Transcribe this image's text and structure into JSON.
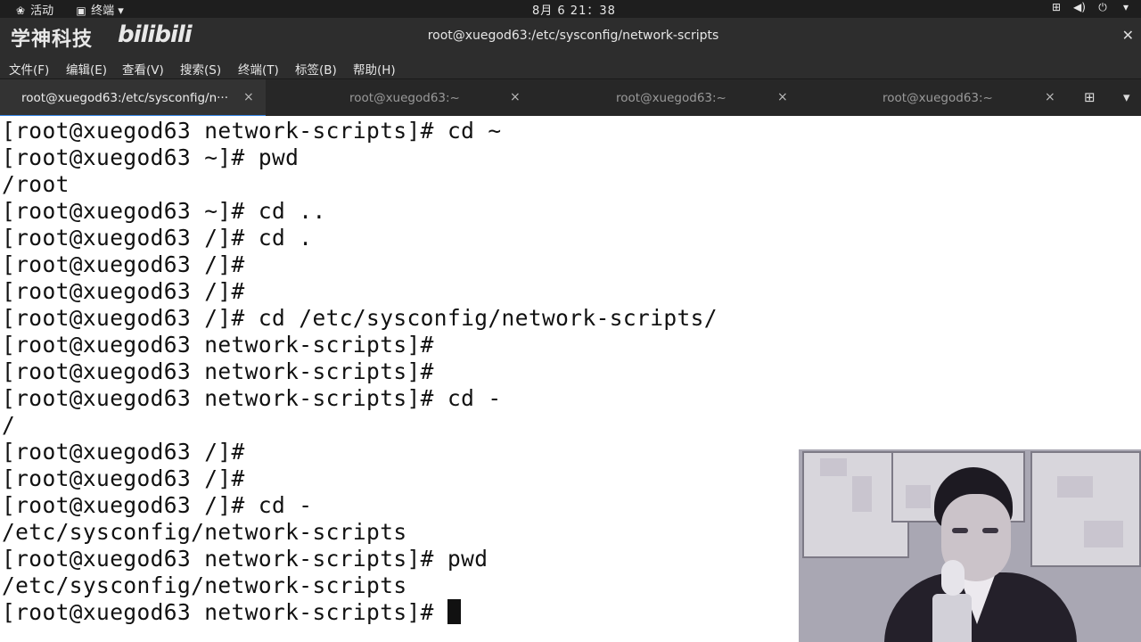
{
  "topbar": {
    "activities": "活动",
    "app_menu": "终端",
    "clock": "8月 6 21：38",
    "icons": [
      "network-icon",
      "volume-icon",
      "power-icon"
    ]
  },
  "window": {
    "watermark": "学神科技",
    "bilibili_logo": "bilibili",
    "title": "root@xuegod63:/etc/sysconfig/network-scripts"
  },
  "menubar": {
    "items": [
      "文件(F)",
      "编辑(E)",
      "查看(V)",
      "搜索(S)",
      "终端(T)",
      "标签(B)",
      "帮助(H)"
    ]
  },
  "tabs": [
    {
      "label": "root@xuegod63:/etc/sysconfig/n···",
      "active": true
    },
    {
      "label": "root@xuegod63:~",
      "active": false
    },
    {
      "label": "root@xuegod63:~",
      "active": false
    },
    {
      "label": "root@xuegod63:~",
      "active": false
    }
  ],
  "terminal": {
    "lines": [
      "[root@xuegod63 network-scripts]# cd ~",
      "[root@xuegod63 ~]# pwd",
      "/root",
      "[root@xuegod63 ~]# cd ..",
      "[root@xuegod63 /]# cd .",
      "[root@xuegod63 /]#",
      "[root@xuegod63 /]#",
      "[root@xuegod63 /]# cd /etc/sysconfig/network-scripts/",
      "[root@xuegod63 network-scripts]#",
      "[root@xuegod63 network-scripts]#",
      "[root@xuegod63 network-scripts]# cd -",
      "/",
      "[root@xuegod63 /]#",
      "[root@xuegod63 /]#",
      "[root@xuegod63 /]# cd -",
      "/etc/sysconfig/network-scripts",
      "[root@xuegod63 network-scripts]# pwd",
      "/etc/sysconfig/network-scripts",
      "[root@xuegod63 network-scripts]# "
    ]
  },
  "colors": {
    "terminal_bg": "#ffffff",
    "terminal_fg": "#111111",
    "chrome_bg": "#2d2d2d",
    "tab_accent": "#3584e4"
  }
}
